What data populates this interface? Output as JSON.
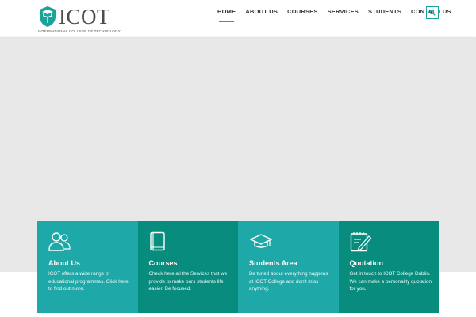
{
  "brand": {
    "name": "ICOT",
    "tagline": "INTERNATIONAL COLLEGE OF TECHNOLOGY",
    "color": "#1aa39b"
  },
  "nav": {
    "items": [
      {
        "label": "HOME",
        "active": true
      },
      {
        "label": "ABOUT US",
        "active": false
      },
      {
        "label": "COURSES",
        "active": false
      },
      {
        "label": "SERVICES",
        "active": false
      },
      {
        "label": "STUDENTS",
        "active": false
      },
      {
        "label": "CONTACT US",
        "active": false
      }
    ],
    "search_icon": "search-icon"
  },
  "colors": {
    "teal_light": "#1fa8a8",
    "teal_dark": "#088c7e",
    "hero_bg": "#e8e8e8"
  },
  "cards": [
    {
      "title": "About Us",
      "text": "ICOT offers a wide range of educational programmes. Click here to find out more.",
      "icon": "users-icon"
    },
    {
      "title": "Courses",
      "text": "Check here all the Services that we provide to make ours students life easier. Be focused.",
      "icon": "book-icon"
    },
    {
      "title": "Students Area",
      "text": "Be tuned about everything happens at ICOT College and don't miss anything.",
      "icon": "graduation-cap-icon"
    },
    {
      "title": "Quotation",
      "text": "Get in touch to ICOT College Dublin. We can make a personality quotation for you.",
      "icon": "notepad-pen-icon"
    }
  ]
}
